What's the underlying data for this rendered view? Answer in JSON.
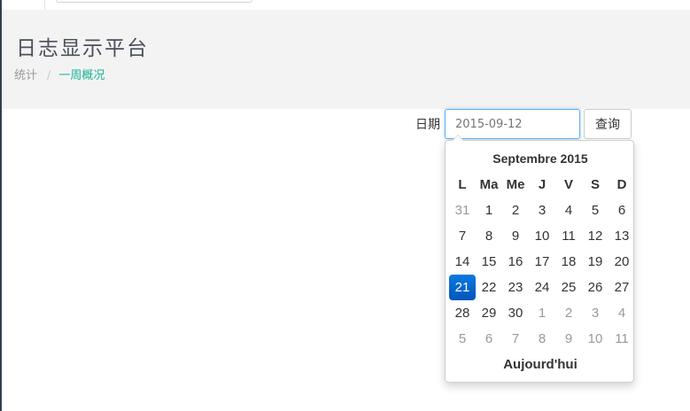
{
  "header": {
    "title": "日志显示平台",
    "breadcrumb": {
      "first": "统计",
      "separator": "/",
      "active": "一周概况"
    }
  },
  "toolbar": {
    "date_label": "日期",
    "date_value": "",
    "date_placeholder": "2015-09-12",
    "query_label": "查询"
  },
  "datepicker": {
    "month_title": "Septembre 2015",
    "days_of_week": [
      "L",
      "Ma",
      "Me",
      "J",
      "V",
      "S",
      "D"
    ],
    "weeks": [
      [
        {
          "d": "31",
          "m": true
        },
        {
          "d": "1"
        },
        {
          "d": "2"
        },
        {
          "d": "3"
        },
        {
          "d": "4"
        },
        {
          "d": "5"
        },
        {
          "d": "6"
        }
      ],
      [
        {
          "d": "7"
        },
        {
          "d": "8"
        },
        {
          "d": "9"
        },
        {
          "d": "10"
        },
        {
          "d": "11"
        },
        {
          "d": "12"
        },
        {
          "d": "13"
        }
      ],
      [
        {
          "d": "14"
        },
        {
          "d": "15"
        },
        {
          "d": "16"
        },
        {
          "d": "17"
        },
        {
          "d": "18"
        },
        {
          "d": "19"
        },
        {
          "d": "20"
        }
      ],
      [
        {
          "d": "21",
          "sel": true
        },
        {
          "d": "22"
        },
        {
          "d": "23"
        },
        {
          "d": "24"
        },
        {
          "d": "25"
        },
        {
          "d": "26"
        },
        {
          "d": "27"
        }
      ],
      [
        {
          "d": "28"
        },
        {
          "d": "29"
        },
        {
          "d": "30"
        },
        {
          "d": "1",
          "m": true
        },
        {
          "d": "2",
          "m": true
        },
        {
          "d": "3",
          "m": true
        },
        {
          "d": "4",
          "m": true
        }
      ],
      [
        {
          "d": "5",
          "m": true
        },
        {
          "d": "6",
          "m": true
        },
        {
          "d": "7",
          "m": true
        },
        {
          "d": "8",
          "m": true
        },
        {
          "d": "9",
          "m": true
        },
        {
          "d": "10",
          "m": true
        },
        {
          "d": "11",
          "m": true
        }
      ]
    ],
    "today_label": "Aujourd'hui"
  },
  "colors": {
    "accent": "#1ab394",
    "selected": "#0568c9",
    "sidebar": "#2f4050",
    "header_bg": "#f3f3f4"
  }
}
